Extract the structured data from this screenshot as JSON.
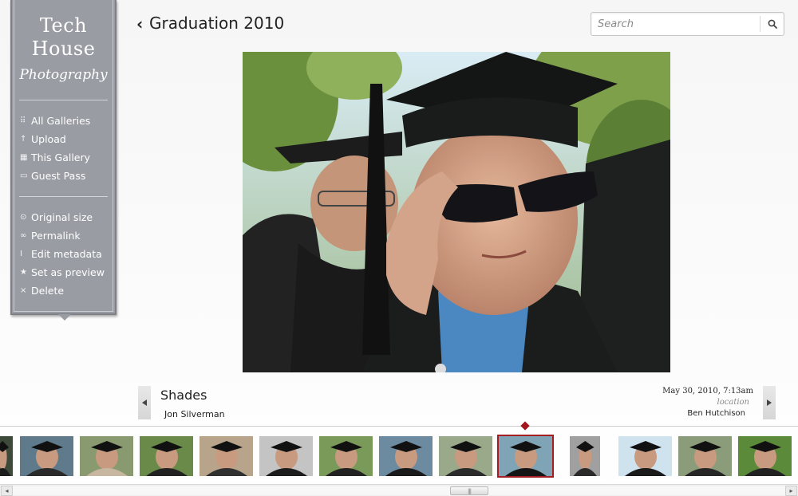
{
  "brand": {
    "line1": "Tech\nHouse",
    "line2": "Photography"
  },
  "sidebar": {
    "primary": [
      {
        "icon": "grid-icon",
        "glyph": "⠿",
        "label": "All Galleries"
      },
      {
        "icon": "upload-icon",
        "glyph": "↑",
        "label": "Upload"
      },
      {
        "icon": "gallery-icon",
        "glyph": "▦",
        "label": "This Gallery"
      },
      {
        "icon": "ticket-icon",
        "glyph": "▭",
        "label": "Guest Pass"
      }
    ],
    "secondary": [
      {
        "icon": "magnifier-icon",
        "glyph": "⊙",
        "label": "Original size"
      },
      {
        "icon": "link-icon",
        "glyph": "∞",
        "label": "Permalink"
      },
      {
        "icon": "text-cursor-icon",
        "glyph": "I",
        "label": "Edit metadata"
      },
      {
        "icon": "star-icon",
        "glyph": "★",
        "label": "Set as preview"
      },
      {
        "icon": "close-icon",
        "glyph": "×",
        "label": "Delete"
      }
    ]
  },
  "header": {
    "back_glyph": "‹",
    "title": "Graduation 2010"
  },
  "search": {
    "placeholder": "Search",
    "value": ""
  },
  "photo": {
    "title": "Shades",
    "author": "Jon Silverman",
    "date": "May 30, 2010, 7:13am",
    "location": "location",
    "owner": "Ben Hutchison"
  },
  "filmstrip": {
    "selected_index": 9,
    "thumbs": [
      {
        "alt": "photo"
      },
      {
        "alt": "photo"
      },
      {
        "alt": "photo"
      },
      {
        "alt": "photo"
      },
      {
        "alt": "photo"
      },
      {
        "alt": "photo"
      },
      {
        "alt": "photo"
      },
      {
        "alt": "photo"
      },
      {
        "alt": "photo"
      },
      {
        "alt": "photo"
      },
      {
        "alt": "photo"
      },
      {
        "alt": "photo"
      },
      {
        "alt": "photo"
      },
      {
        "alt": "photo"
      }
    ]
  },
  "colors": {
    "sidebar": "#9a9ca3",
    "accent": "#a4141b",
    "text": "#222222"
  }
}
